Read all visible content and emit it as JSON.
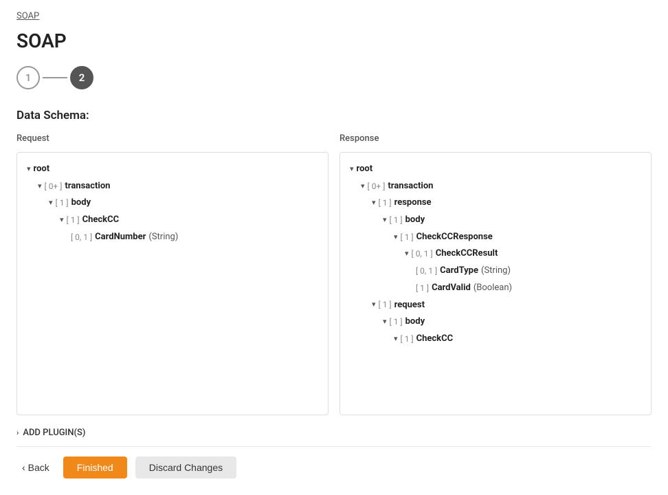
{
  "breadcrumb": {
    "label": "SOAP"
  },
  "page": {
    "title": "SOAP"
  },
  "steps": [
    {
      "number": "1",
      "state": "inactive"
    },
    {
      "number": "2",
      "state": "active"
    }
  ],
  "section": {
    "heading": "Data Schema:"
  },
  "request_panel": {
    "label": "Request",
    "tree": [
      {
        "indent": 0,
        "chevron": "▾",
        "bracket": "",
        "name": "root",
        "bold": true,
        "type": ""
      },
      {
        "indent": 1,
        "chevron": "▾",
        "bracket": "[ 0+ ]",
        "name": "transaction",
        "bold": true,
        "type": ""
      },
      {
        "indent": 2,
        "chevron": "▾",
        "bracket": "[ 1 ]",
        "name": "body",
        "bold": true,
        "type": ""
      },
      {
        "indent": 3,
        "chevron": "▾",
        "bracket": "[ 1 ]",
        "name": "CheckCC",
        "bold": true,
        "type": ""
      },
      {
        "indent": 4,
        "chevron": "",
        "bracket": "[ 0, 1 ]",
        "name": "CardNumber",
        "bold": true,
        "type": "(String)"
      }
    ]
  },
  "response_panel": {
    "label": "Response",
    "tree": [
      {
        "indent": 0,
        "chevron": "▾",
        "bracket": "",
        "name": "root",
        "bold": true,
        "type": ""
      },
      {
        "indent": 1,
        "chevron": "▾",
        "bracket": "[ 0+ ]",
        "name": "transaction",
        "bold": true,
        "type": ""
      },
      {
        "indent": 2,
        "chevron": "▾",
        "bracket": "[ 1 ]",
        "name": "response",
        "bold": true,
        "type": ""
      },
      {
        "indent": 3,
        "chevron": "▾",
        "bracket": "[ 1 ]",
        "name": "body",
        "bold": true,
        "type": ""
      },
      {
        "indent": 4,
        "chevron": "▾",
        "bracket": "[ 1 ]",
        "name": "CheckCCResponse",
        "bold": true,
        "type": ""
      },
      {
        "indent": 5,
        "chevron": "▾",
        "bracket": "[ 0, 1 ]",
        "name": "CheckCCResult",
        "bold": true,
        "type": ""
      },
      {
        "indent": 6,
        "chevron": "",
        "bracket": "[ 0, 1 ]",
        "name": "CardType",
        "bold": true,
        "type": "(String)"
      },
      {
        "indent": 6,
        "chevron": "",
        "bracket": "[ 1 ]",
        "name": "CardValid",
        "bold": true,
        "type": "(Boolean)"
      },
      {
        "indent": 2,
        "chevron": "▾",
        "bracket": "[ 1 ]",
        "name": "request",
        "bold": true,
        "type": ""
      },
      {
        "indent": 3,
        "chevron": "▾",
        "bracket": "[ 1 ]",
        "name": "body",
        "bold": true,
        "type": ""
      },
      {
        "indent": 4,
        "chevron": "▾",
        "bracket": "[ 1 ]",
        "name": "CheckCC",
        "bold": true,
        "type": ""
      }
    ]
  },
  "add_plugin": {
    "label": "ADD PLUGIN(S)"
  },
  "footer": {
    "back_label": "Back",
    "finished_label": "Finished",
    "discard_label": "Discard Changes"
  },
  "colors": {
    "finished_btn_bg": "#f0891a",
    "discard_btn_bg": "#e0e0e0"
  }
}
